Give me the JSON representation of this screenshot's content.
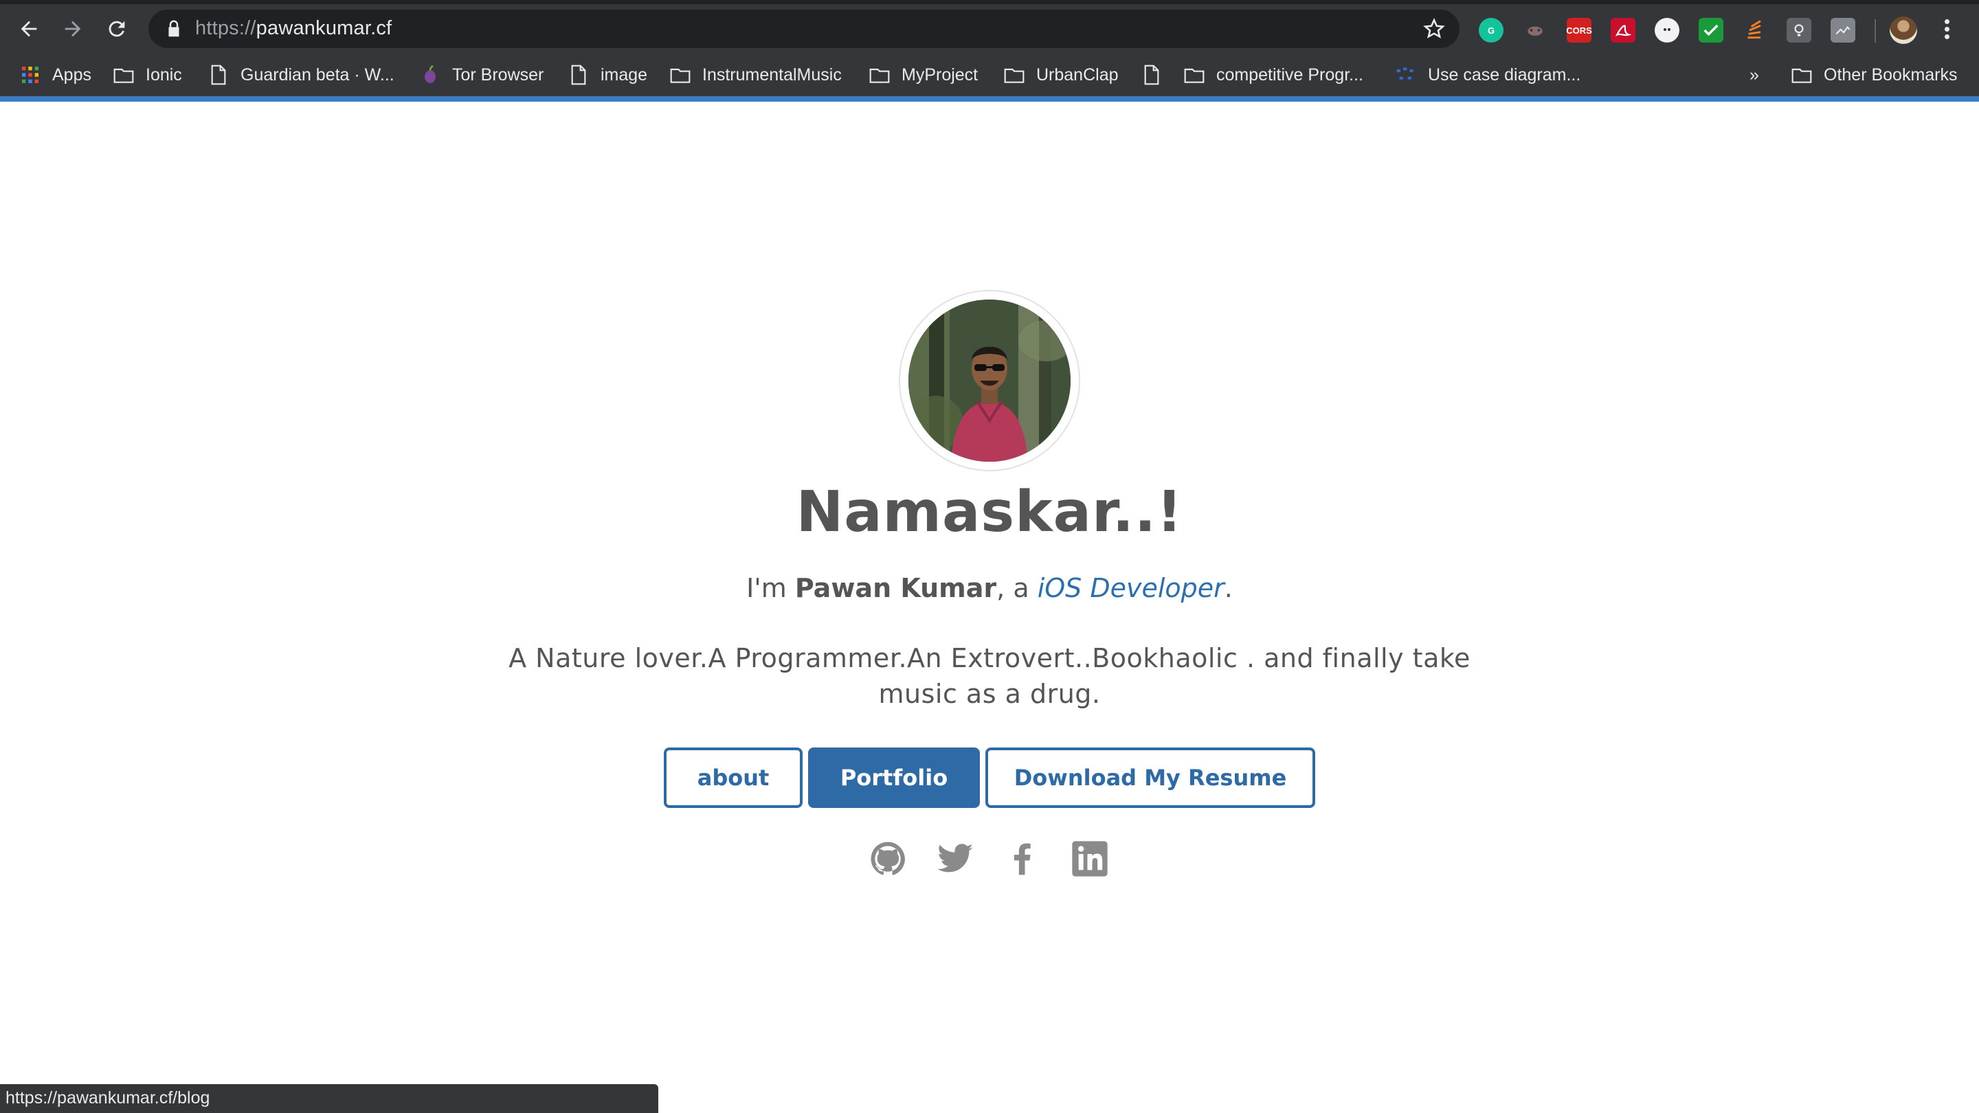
{
  "browser": {
    "url_scheme": "https://",
    "url_host": "pawankumar.cf",
    "extensions": [
      "grammarly-icon",
      "bug-icon",
      "cors-icon",
      "pdf-icon",
      "ghostery-icon",
      "check-icon",
      "stack-icon",
      "bulb-icon",
      "screenshot-icon"
    ],
    "extension_labels": {
      "cors": "CORS"
    },
    "bookmarks": [
      {
        "label": "Apps",
        "icon": "apps-grid-icon"
      },
      {
        "label": "Ionic",
        "icon": "folder-icon"
      },
      {
        "label": "Guardian beta · W...",
        "icon": "page-icon"
      },
      {
        "label": "Tor Browser",
        "icon": "onion-icon"
      },
      {
        "label": "image",
        "icon": "page-icon"
      },
      {
        "label": "InstrumentalMusic",
        "icon": "folder-icon"
      },
      {
        "label": "MyProject",
        "icon": "folder-icon"
      },
      {
        "label": "UrbanClap",
        "icon": "folder-icon"
      },
      {
        "label": "",
        "icon": "page-icon"
      },
      {
        "label": "competitive Progr...",
        "icon": "folder-icon"
      },
      {
        "label": "Use case diagram...",
        "icon": "diagram-icon"
      }
    ],
    "overflow_label": "»",
    "other_bookmarks": "Other Bookmarks",
    "status_url": "https://pawankumar.cf/blog",
    "accent_color": "#3a7bc4"
  },
  "hero": {
    "title": "Namaskar..!",
    "intro_prefix": "I'm ",
    "name": "Pawan Kumar",
    "intro_mid": ", a ",
    "role": "iOS Developer",
    "intro_suffix": ".",
    "tagline": "A Nature lover.A Programmer.An Extrovert..Bookhaolic . and finally take music as a drug.",
    "brand_color": "#2d6aa6"
  },
  "buttons": {
    "about": "about",
    "portfolio": "Portfolio",
    "resume": "Download My Resume"
  },
  "social": [
    "github-icon",
    "twitter-icon",
    "facebook-icon",
    "linkedin-icon"
  ]
}
